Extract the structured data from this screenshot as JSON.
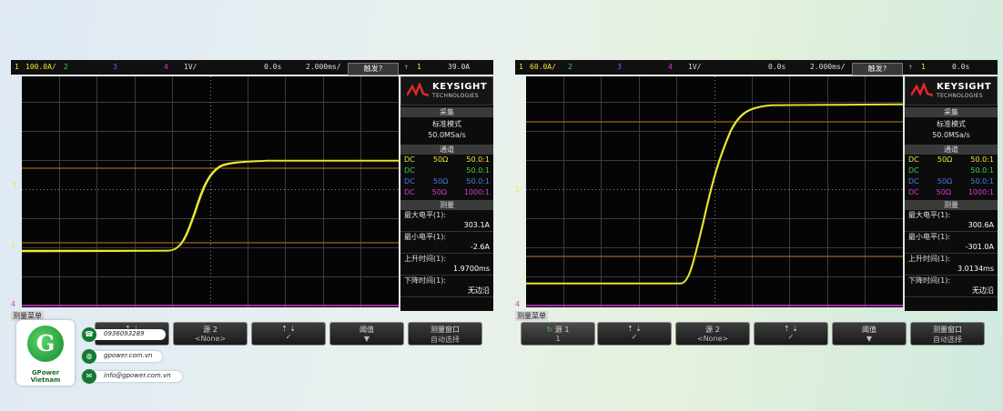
{
  "colors": {
    "ch1": "#f0e82c",
    "ch2": "#3bd14a",
    "ch3": "#4a7cf0",
    "ch4": "#d63ad1",
    "cursor": "#c47a1a",
    "screen_bg": "#050505"
  },
  "scopes": [
    {
      "topbar": {
        "ch1_num": "1",
        "ch1_scale": "100.0A/",
        "ch2_num": "2",
        "ch3_num": "3",
        "ch4_num": "4",
        "ch4_scale": "1V/",
        "delay": "0.0s",
        "timebase": "2.000ms/",
        "trig_mode": "触发?",
        "trig_src": "1",
        "trig_level": "39.0A"
      },
      "panel": {
        "brand": "KEYSIGHT",
        "brand_sub": "TECHNOLOGIES",
        "acq_title": "采集",
        "acq_mode": "标准模式",
        "acq_rate": "50.0MSa/s",
        "chan_title": "通道",
        "channels": [
          {
            "coupling": "DC",
            "imp": "50Ω",
            "probe": "50.0:1"
          },
          {
            "coupling": "DC",
            "imp": "",
            "probe": "50.0:1"
          },
          {
            "coupling": "DC",
            "imp": "50Ω",
            "probe": "50.0:1"
          },
          {
            "coupling": "DC",
            "imp": "50Ω",
            "probe": "1000:1"
          }
        ],
        "meas_title": "测量",
        "measurements": [
          {
            "label": "最大电平(1):",
            "value": "303.1A"
          },
          {
            "label": "最小电平(1):",
            "value": "-2.6A"
          },
          {
            "label": "上升时间(1):",
            "value": "1.9700ms"
          },
          {
            "label": "下降时间(1):",
            "value": "无边沿"
          }
        ]
      },
      "bottom": {
        "menu_title": "测量菜单",
        "keys": [
          {
            "l1": "",
            "l2": ""
          },
          {
            "l1": "源 2",
            "l2": "<None>"
          },
          {
            "l1": "",
            "l2": ""
          },
          {
            "l1": "阈值",
            "l2": "▼"
          },
          {
            "l1": "测量窗口",
            "l2": "自动选择"
          }
        ]
      }
    },
    {
      "topbar": {
        "ch1_num": "1",
        "ch1_scale": "60.0A/",
        "ch2_num": "2",
        "ch3_num": "3",
        "ch4_num": "4",
        "ch4_scale": "1V/",
        "delay": "0.0s",
        "timebase": "2.000ms/",
        "trig_mode": "触发?",
        "trig_src": "1",
        "trig_level": "0.0s"
      },
      "panel": {
        "brand": "KEYSIGHT",
        "brand_sub": "TECHNOLOGIES",
        "acq_title": "采集",
        "acq_mode": "标准模式",
        "acq_rate": "50.0MSa/s",
        "chan_title": "通道",
        "channels": [
          {
            "coupling": "DC",
            "imp": "50Ω",
            "probe": "50.0:1"
          },
          {
            "coupling": "DC",
            "imp": "",
            "probe": "50.0:1"
          },
          {
            "coupling": "DC",
            "imp": "50Ω",
            "probe": "50.0:1"
          },
          {
            "coupling": "DC",
            "imp": "50Ω",
            "probe": "1000:1"
          }
        ],
        "meas_title": "测量",
        "measurements": [
          {
            "label": "最大电平(1):",
            "value": "300.6A"
          },
          {
            "label": "最小电平(1):",
            "value": "-301.0A"
          },
          {
            "label": "上升时间(1):",
            "value": "3.0134ms"
          },
          {
            "label": "下降时间(1):",
            "value": "无边沿"
          }
        ]
      },
      "bottom": {
        "menu_title": "测量菜单",
        "keys": [
          {
            "l1": "源 1",
            "l2": "1"
          },
          {
            "l1": "",
            "l2": ""
          },
          {
            "l1": "源 2",
            "l2": "<None>"
          },
          {
            "l1": "",
            "l2": ""
          },
          {
            "l1": "阈值",
            "l2": "▼"
          },
          {
            "l1": "测量窗口",
            "l2": "自动选择"
          }
        ]
      }
    }
  ],
  "company": {
    "name": "GPower Vietnam",
    "logo_letter": "G",
    "phone": "0936093289",
    "website": "gpower.com.vn",
    "email": "info@gpower.com.vn"
  }
}
